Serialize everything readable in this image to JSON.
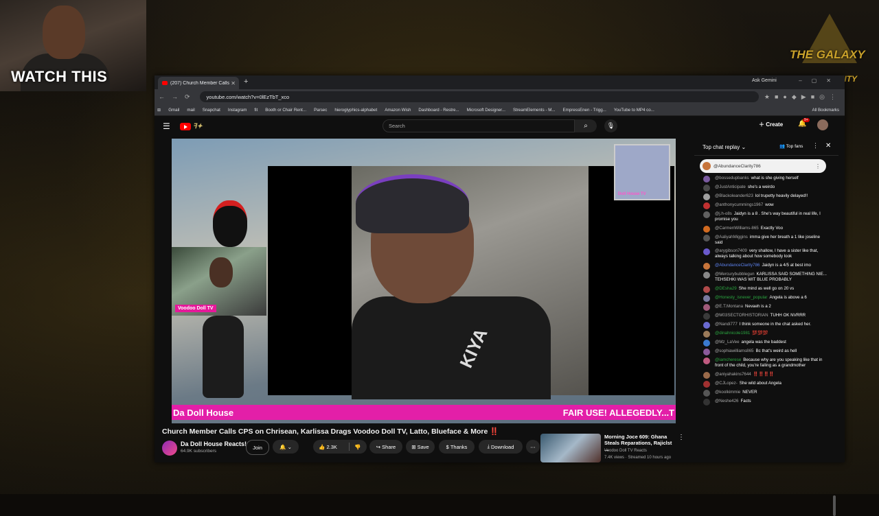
{
  "overlay": {
    "cam_label": "WATCH THIS",
    "galaxy_text": "THE GALAXY",
    "galaxy_sub": "UNITY"
  },
  "browser": {
    "tab_title": "(207) Church Member Calls",
    "gemini": "Ask Gemini",
    "url": "youtube.com/watch?v=0lEzTbT_xco",
    "bookmarks": [
      "Gmail",
      "mail",
      "Snapchat",
      "Instagram",
      "fit",
      "Booth or Chair Rent...",
      "Parsec",
      "hieroglyphics-alphabet",
      "Amazon Wish",
      "Dashboard - Restre...",
      "Microsoft Designer...",
      "StreamElements - M...",
      "EmpressEnen - Trigg...",
      "YouTube to MP4 co..."
    ],
    "all_bookmarks": "All Bookmarks"
  },
  "youtube": {
    "search_placeholder": "Search",
    "create_label": "Create",
    "notif_count": "9+",
    "video_overlay_left": "Da Doll House",
    "video_overlay_right": "FAIR USE! ALLEGEDLY...T",
    "pip_tag": "Voodoo Doll TV",
    "video_title": "Church Member Calls CPS on Chrisean, Karlissa Drags Voodoo Doll TV, Latto, Blueface & More ‼️",
    "channel_name": "Da Doll House Reacts!",
    "subscribers": "64.9K subscribers",
    "join": "Join",
    "likes": "2.3K",
    "share": "Share",
    "save": "Save",
    "thanks": "Thanks",
    "download": "Download"
  },
  "recommended": {
    "title": "Morning Joce 609: Ghana Steals Reparations, Rajiclst ...",
    "channel": "Voodoo Doll TV Reacts",
    "meta": "7.4K views · Streamed 10 hours ago"
  },
  "chat": {
    "header": "Top chat replay",
    "top_fans": "Top fans",
    "pinned_author": "@AbundanceClarity786",
    "messages": [
      {
        "author": "@bossedupbanks",
        "text": "what is she giving herself",
        "color": "#7a5aa0",
        "cls": ""
      },
      {
        "author": "@JustAnticipate",
        "text": "she's a weirdo",
        "color": "#4a4a4a",
        "cls": ""
      },
      {
        "author": "@Blackoleander623",
        "text": "lol trupetty heavily delayed!!",
        "color": "#a0a0a0",
        "cls": ""
      },
      {
        "author": "@anthonycummings1967",
        "text": "wow",
        "color": "#c03030",
        "cls": ""
      },
      {
        "author": "@j.h-o8s",
        "text": "Jaidyn is a 8 . She's way beautiful in real life, I promise you",
        "color": "#606060",
        "cls": ""
      },
      {
        "author": "@CarmenWilliams-865",
        "text": "Exactly Voo",
        "color": "#d06a20",
        "cls": ""
      },
      {
        "author": "@AaliyahMiggins",
        "text": "imma give her breath a 1 like joseline said",
        "color": "#555",
        "cls": ""
      },
      {
        "author": "@arygibson7409",
        "text": "very shallow, I have a sister like that, always talking about how somebody look",
        "color": "#6a5acd",
        "cls": ""
      },
      {
        "author": "@AbundanceClarity786",
        "text": "Jaidyn is a 4/5 at best imo",
        "color": "#c7743a",
        "cls": "b"
      },
      {
        "author": "@Mercurybubblegun",
        "text": "KARLISSA SAID SOMETHING NIE... TEHSEHKI WAS WIT BLUE PROBABLY",
        "color": "#888",
        "cls": ""
      },
      {
        "author": "@DEsha29",
        "text": "She mind as well go on 20 vs",
        "color": "#b04a4a",
        "cls": "g"
      },
      {
        "author": "@Honesty_isnever_popular",
        "text": "Angela is above a 6",
        "color": "#7a7aa0",
        "cls": "g"
      },
      {
        "author": "@E.T.Montana",
        "text": "Nevaeh is a 2",
        "color": "#a05a7a",
        "cls": ""
      },
      {
        "author": "@M03SECTORHISTORIAN",
        "text": "TUHH OK NVRRR",
        "color": "#3a3a3a",
        "cls": ""
      },
      {
        "author": "@Nandi777",
        "text": "I think someone in the chat asked her.",
        "color": "#6a6ad0",
        "cls": ""
      },
      {
        "author": "@dinahnicole1981",
        "text": "💯💯💯",
        "color": "#9a7a5a",
        "cls": "g"
      },
      {
        "author": "@Mz_LaVee",
        "text": "angela was the baddest",
        "color": "#3a7ad0",
        "cls": ""
      },
      {
        "author": "@sophiawilliams865",
        "text": "Bc that's weird as hell",
        "color": "#8a5a9a",
        "cls": ""
      },
      {
        "author": "@iamcherese",
        "text": "Because why are you speaking like that in front of the child, you're failing as a grandmother",
        "color": "#c05a80",
        "cls": "g"
      },
      {
        "author": "@aniyahakins7644",
        "text": "‼️‼️‼️‼️",
        "color": "#9a6a4a",
        "cls": ""
      },
      {
        "author": "@CJLopez-",
        "text": "She wild about Angela",
        "color": "#a03030",
        "cls": ""
      },
      {
        "author": "@koolkimmie",
        "text": "NEVER",
        "color": "#555",
        "cls": ""
      },
      {
        "author": "@Neshe426",
        "text": "Facts",
        "color": "#333",
        "cls": ""
      }
    ]
  }
}
